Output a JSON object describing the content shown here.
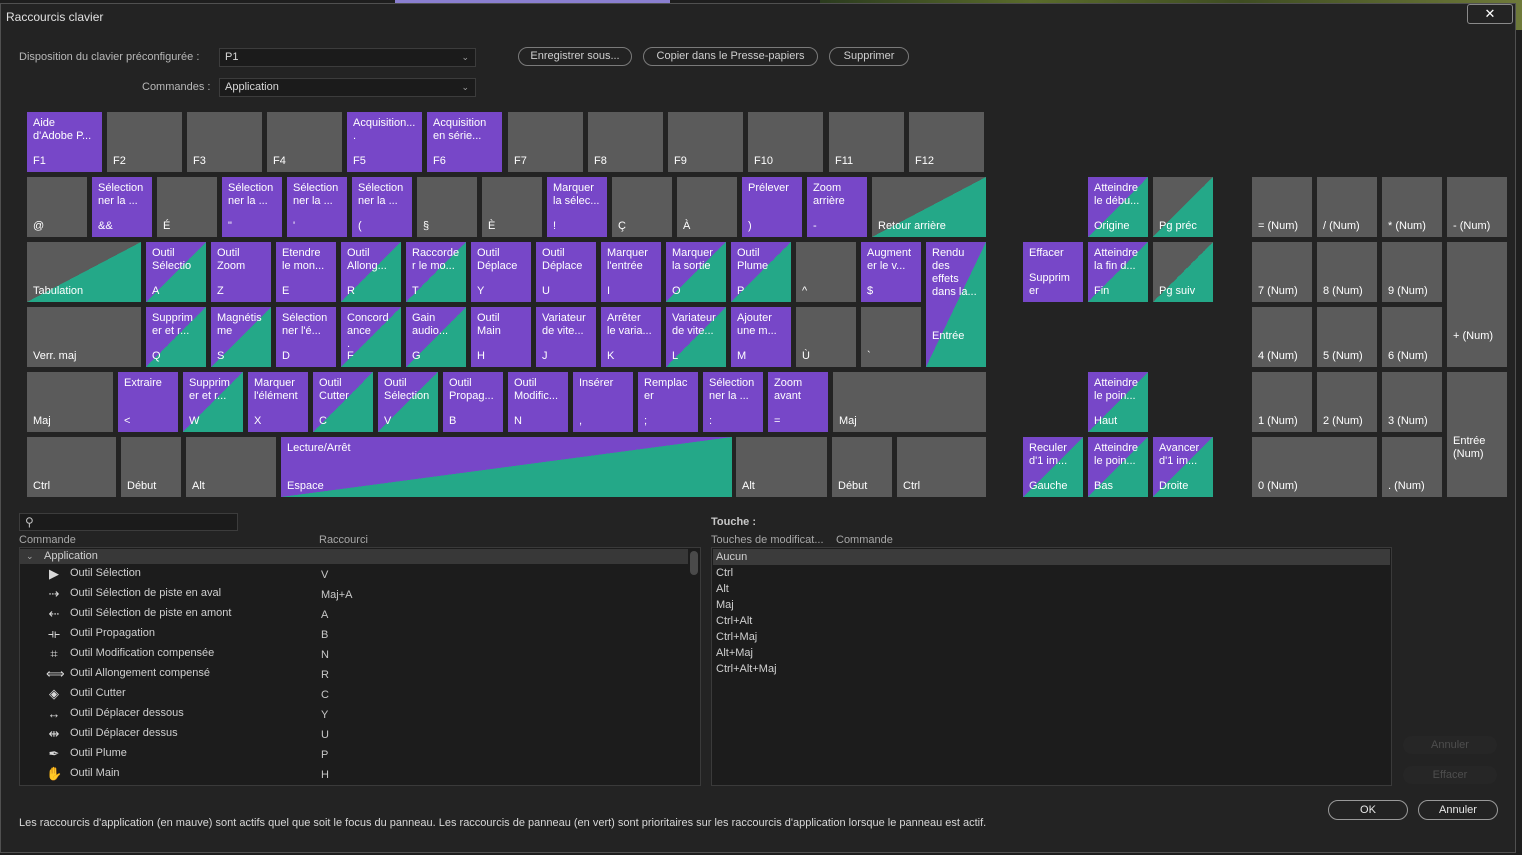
{
  "window": {
    "title": "Raccourcis clavier",
    "close": "✕"
  },
  "top": {
    "preset_label": "Disposition du clavier préconfigurée :",
    "preset_value": "P1",
    "commands_label": "Commandes :",
    "commands_value": "Application",
    "save_as": "Enregistrer sous...",
    "copy_clipboard": "Copier dans le Presse-papiers",
    "delete": "Supprimer"
  },
  "keyboard": {
    "rows": [
      [
        {
          "k": "F1",
          "c": "Aide\nd'Adobe P...",
          "t": "app"
        },
        {
          "k": "F2"
        },
        {
          "k": "F3"
        },
        {
          "k": "F4"
        },
        {
          "k": "F5",
          "c": "Acquisition...\n.",
          "t": "app"
        },
        {
          "k": "F6",
          "c": "Acquisition\nen série...",
          "t": "app"
        },
        {
          "k": "F7"
        },
        {
          "k": "F8"
        },
        {
          "k": "F9"
        },
        {
          "k": "F10"
        },
        {
          "k": "F11"
        },
        {
          "k": "F12"
        }
      ],
      [
        {
          "k": "@"
        },
        {
          "k": "&&",
          "c": "Sélection\nner la ...",
          "t": "app"
        },
        {
          "k": "É"
        },
        {
          "k": "\"",
          "c": "Sélection\nner la ...",
          "t": "app"
        },
        {
          "k": "'",
          "c": "Sélection\nner la ...",
          "t": "app"
        },
        {
          "k": "(",
          "c": "Sélection\nner la ...",
          "t": "app"
        },
        {
          "k": "§"
        },
        {
          "k": "È"
        },
        {
          "k": "!",
          "c": "Marquer\nla sélec...",
          "t": "app"
        },
        {
          "k": "Ç"
        },
        {
          "k": "À"
        },
        {
          "k": ")",
          "c": "Prélever",
          "t": "app"
        },
        {
          "k": "-",
          "c": "Zoom\narrière",
          "t": "app"
        },
        {
          "k": "Retour arrière",
          "t": "gp"
        }
      ],
      [
        {
          "k": "Tabulation",
          "t": "gp"
        },
        {
          "k": "A",
          "c": "Outil\nSélectio",
          "t": "panel"
        },
        {
          "k": "Z",
          "c": "Outil\nZoom",
          "t": "app"
        },
        {
          "k": "E",
          "c": "Etendre\nle mon...",
          "t": "app"
        },
        {
          "k": "R",
          "c": "Outil\nAllong...",
          "t": "panel"
        },
        {
          "k": "T",
          "c": "Raccorde\nr le mo...",
          "t": "panel"
        },
        {
          "k": "Y",
          "c": "Outil\nDéplace",
          "t": "app"
        },
        {
          "k": "U",
          "c": "Outil\nDéplace",
          "t": "app"
        },
        {
          "k": "I",
          "c": "Marquer\nl'entrée",
          "t": "app"
        },
        {
          "k": "O",
          "c": "Marquer\nla sortie",
          "t": "panel"
        },
        {
          "k": "P",
          "c": "Outil\nPlume",
          "t": "panel"
        },
        {
          "k": "^"
        },
        {
          "k": "$",
          "c": "Augment\ner le v...",
          "t": "app"
        }
      ],
      [
        {
          "k": "Verr. maj"
        },
        {
          "k": "Q",
          "c": "Supprim\ner et r...",
          "t": "panel"
        },
        {
          "k": "S",
          "c": "Magnétis\nme",
          "t": "panel"
        },
        {
          "k": "D",
          "c": "Sélection\nner l'é...",
          "t": "app"
        },
        {
          "k": "F",
          "c": "Concord\nance\n.",
          "t": "panel"
        },
        {
          "k": "G",
          "c": "Gain\naudio...",
          "t": "panel"
        },
        {
          "k": "H",
          "c": "Outil\nMain",
          "t": "app"
        },
        {
          "k": "J",
          "c": "Variateur\nde vite...",
          "t": "app"
        },
        {
          "k": "K",
          "c": "Arrêter\nle varia...",
          "t": "app"
        },
        {
          "k": "L",
          "c": "Variateur\nde vite...",
          "t": "panel"
        },
        {
          "k": "M",
          "c": "Ajouter\nune m...",
          "t": "app"
        },
        {
          "k": "Ù"
        },
        {
          "k": "`"
        }
      ],
      [
        {
          "k": "Maj"
        },
        {
          "k": "<",
          "c": "Extraire",
          "t": "app"
        },
        {
          "k": "W",
          "c": "Supprim\ner et r...",
          "t": "panel"
        },
        {
          "k": "X",
          "c": "Marquer\nl'élément",
          "t": "app"
        },
        {
          "k": "C",
          "c": "Outil\nCutter",
          "t": "panel"
        },
        {
          "k": "V",
          "c": "Outil\nSélection",
          "t": "panel"
        },
        {
          "k": "B",
          "c": "Outil\nPropag...",
          "t": "app"
        },
        {
          "k": "N",
          "c": "Outil\nModific...",
          "t": "app"
        },
        {
          "k": ",",
          "c": "Insérer",
          "t": "app"
        },
        {
          "k": ";",
          "c": "Remplac\ner",
          "t": "app"
        },
        {
          "k": ":",
          "c": "Sélection\nner la ...",
          "t": "app"
        },
        {
          "k": "=",
          "c": "Zoom\navant",
          "t": "app"
        },
        {
          "k": "Maj"
        }
      ],
      [
        {
          "k": "Ctrl"
        },
        {
          "k": "Début"
        },
        {
          "k": "Alt"
        },
        {
          "k": "Espace",
          "c": "Lecture/Arrêt",
          "t": "panel"
        },
        {
          "k": "Alt"
        },
        {
          "k": "Début"
        },
        {
          "k": "Ctrl"
        }
      ]
    ],
    "enter": {
      "k": "Entrée",
      "c": "Rendu\ndes\neffets\ndans la...",
      "t": "panel"
    },
    "nav": [
      {
        "k": "Origine",
        "c": "Atteindre\nle débu...",
        "t": "panel"
      },
      {
        "k": "Pg préc",
        "t": "gp"
      },
      {
        "k": "Supprim\ner",
        "c": "Effacer",
        "t": "app"
      },
      {
        "k": "Fin",
        "c": "Atteindre\nla fin d...",
        "t": "panel"
      },
      {
        "k": "Pg suiv",
        "t": "gp"
      },
      {
        "k": "Haut",
        "c": "Atteindre\nle poin...",
        "t": "panel"
      },
      {
        "k": "Gauche",
        "c": "Reculer\nd'1 im...",
        "t": "panel"
      },
      {
        "k": "Bas",
        "c": "Atteindre\nle poin...",
        "t": "panel"
      },
      {
        "k": "Droite",
        "c": "Avancer\nd'1 im...",
        "t": "panel"
      }
    ],
    "numpad": [
      {
        "k": "= (Num)"
      },
      {
        "k": "/ (Num)"
      },
      {
        "k": "* (Num)"
      },
      {
        "k": "- (Num)"
      },
      {
        "k": "7 (Num)"
      },
      {
        "k": "8 (Num)"
      },
      {
        "k": "9 (Num)"
      },
      {
        "k": "+ (Num)"
      },
      {
        "k": "4 (Num)"
      },
      {
        "k": "5 (Num)"
      },
      {
        "k": "6 (Num)"
      },
      {
        "k": "1 (Num)"
      },
      {
        "k": "2 (Num)"
      },
      {
        "k": "3 (Num)"
      },
      {
        "k": "Entrée\n(Num)"
      },
      {
        "k": "0 (Num)"
      },
      {
        "k": ". (Num)"
      }
    ]
  },
  "commands": {
    "col_command": "Commande",
    "col_shortcut": "Raccourci",
    "group": "Application",
    "items": [
      {
        "name": "Outil Sélection",
        "shortcut": "V",
        "icon": "selection-arrow-icon",
        "glyph": "▶"
      },
      {
        "name": "Outil Sélection de piste en aval",
        "shortcut": "Maj+A",
        "icon": "track-select-forward-icon",
        "glyph": "⇢"
      },
      {
        "name": "Outil Sélection de piste en amont",
        "shortcut": "A",
        "icon": "track-select-backward-icon",
        "glyph": "⇠"
      },
      {
        "name": "Outil Propagation",
        "shortcut": "B",
        "icon": "ripple-edit-icon",
        "glyph": "⟛"
      },
      {
        "name": "Outil Modification compensée",
        "shortcut": "N",
        "icon": "rolling-edit-icon",
        "glyph": "⌗"
      },
      {
        "name": "Outil Allongement compensé",
        "shortcut": "R",
        "icon": "rate-stretch-icon",
        "glyph": "⟺"
      },
      {
        "name": "Outil Cutter",
        "shortcut": "C",
        "icon": "razor-icon",
        "glyph": "◈"
      },
      {
        "name": "Outil Déplacer dessous",
        "shortcut": "Y",
        "icon": "slip-icon",
        "glyph": "↔"
      },
      {
        "name": "Outil Déplacer dessus",
        "shortcut": "U",
        "icon": "slide-icon",
        "glyph": "⇹"
      },
      {
        "name": "Outil Plume",
        "shortcut": "P",
        "icon": "pen-icon",
        "glyph": "✒"
      },
      {
        "name": "Outil Main",
        "shortcut": "H",
        "icon": "hand-icon",
        "glyph": "✋"
      }
    ]
  },
  "keys_panel": {
    "title": "Touche :",
    "col_modifiers": "Touches de modificat...",
    "col_command": "Commande",
    "rows": [
      "Aucun",
      "Ctrl",
      "Alt",
      "Maj",
      "Ctrl+Alt",
      "Ctrl+Maj",
      "Alt+Maj",
      "Ctrl+Alt+Maj"
    ],
    "undo": "Annuler",
    "clear": "Effacer"
  },
  "footer": {
    "note": "Les raccourcis d'application (en mauve) sont actifs quel que soit le focus du panneau. Les raccourcis de panneau (en vert) sont prioritaires sur les raccourcis d'application lorsque le panneau est actif.",
    "ok": "OK",
    "cancel": "Annuler"
  },
  "colors": {
    "application": "#7747c8",
    "panel": "#24a888",
    "unassigned": "#5b5b5b"
  }
}
